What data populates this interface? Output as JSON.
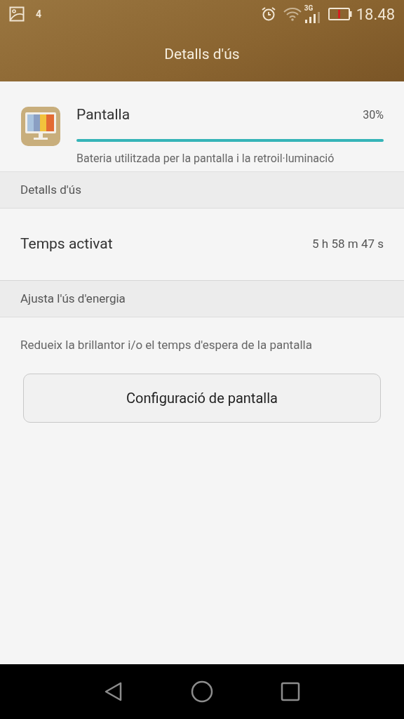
{
  "status_bar": {
    "notification_count": "4",
    "network": "3G",
    "time": "18.48"
  },
  "title": "Detalls d'ús",
  "app": {
    "name": "Pantalla",
    "percent": "30%",
    "description": "Bateria utilitzada per la pantalla i la retroil·luminació"
  },
  "sections": [
    {
      "header": "Detalls d'ús",
      "rows": [
        {
          "label": "Temps activat",
          "value": "5 h 58 m 47 s"
        }
      ]
    },
    {
      "header": "Ajusta l'ús d'energia",
      "note": "Redueix la brillantor i/o el temps d'espera de la pantalla",
      "button": "Configuració de pantalla"
    }
  ]
}
